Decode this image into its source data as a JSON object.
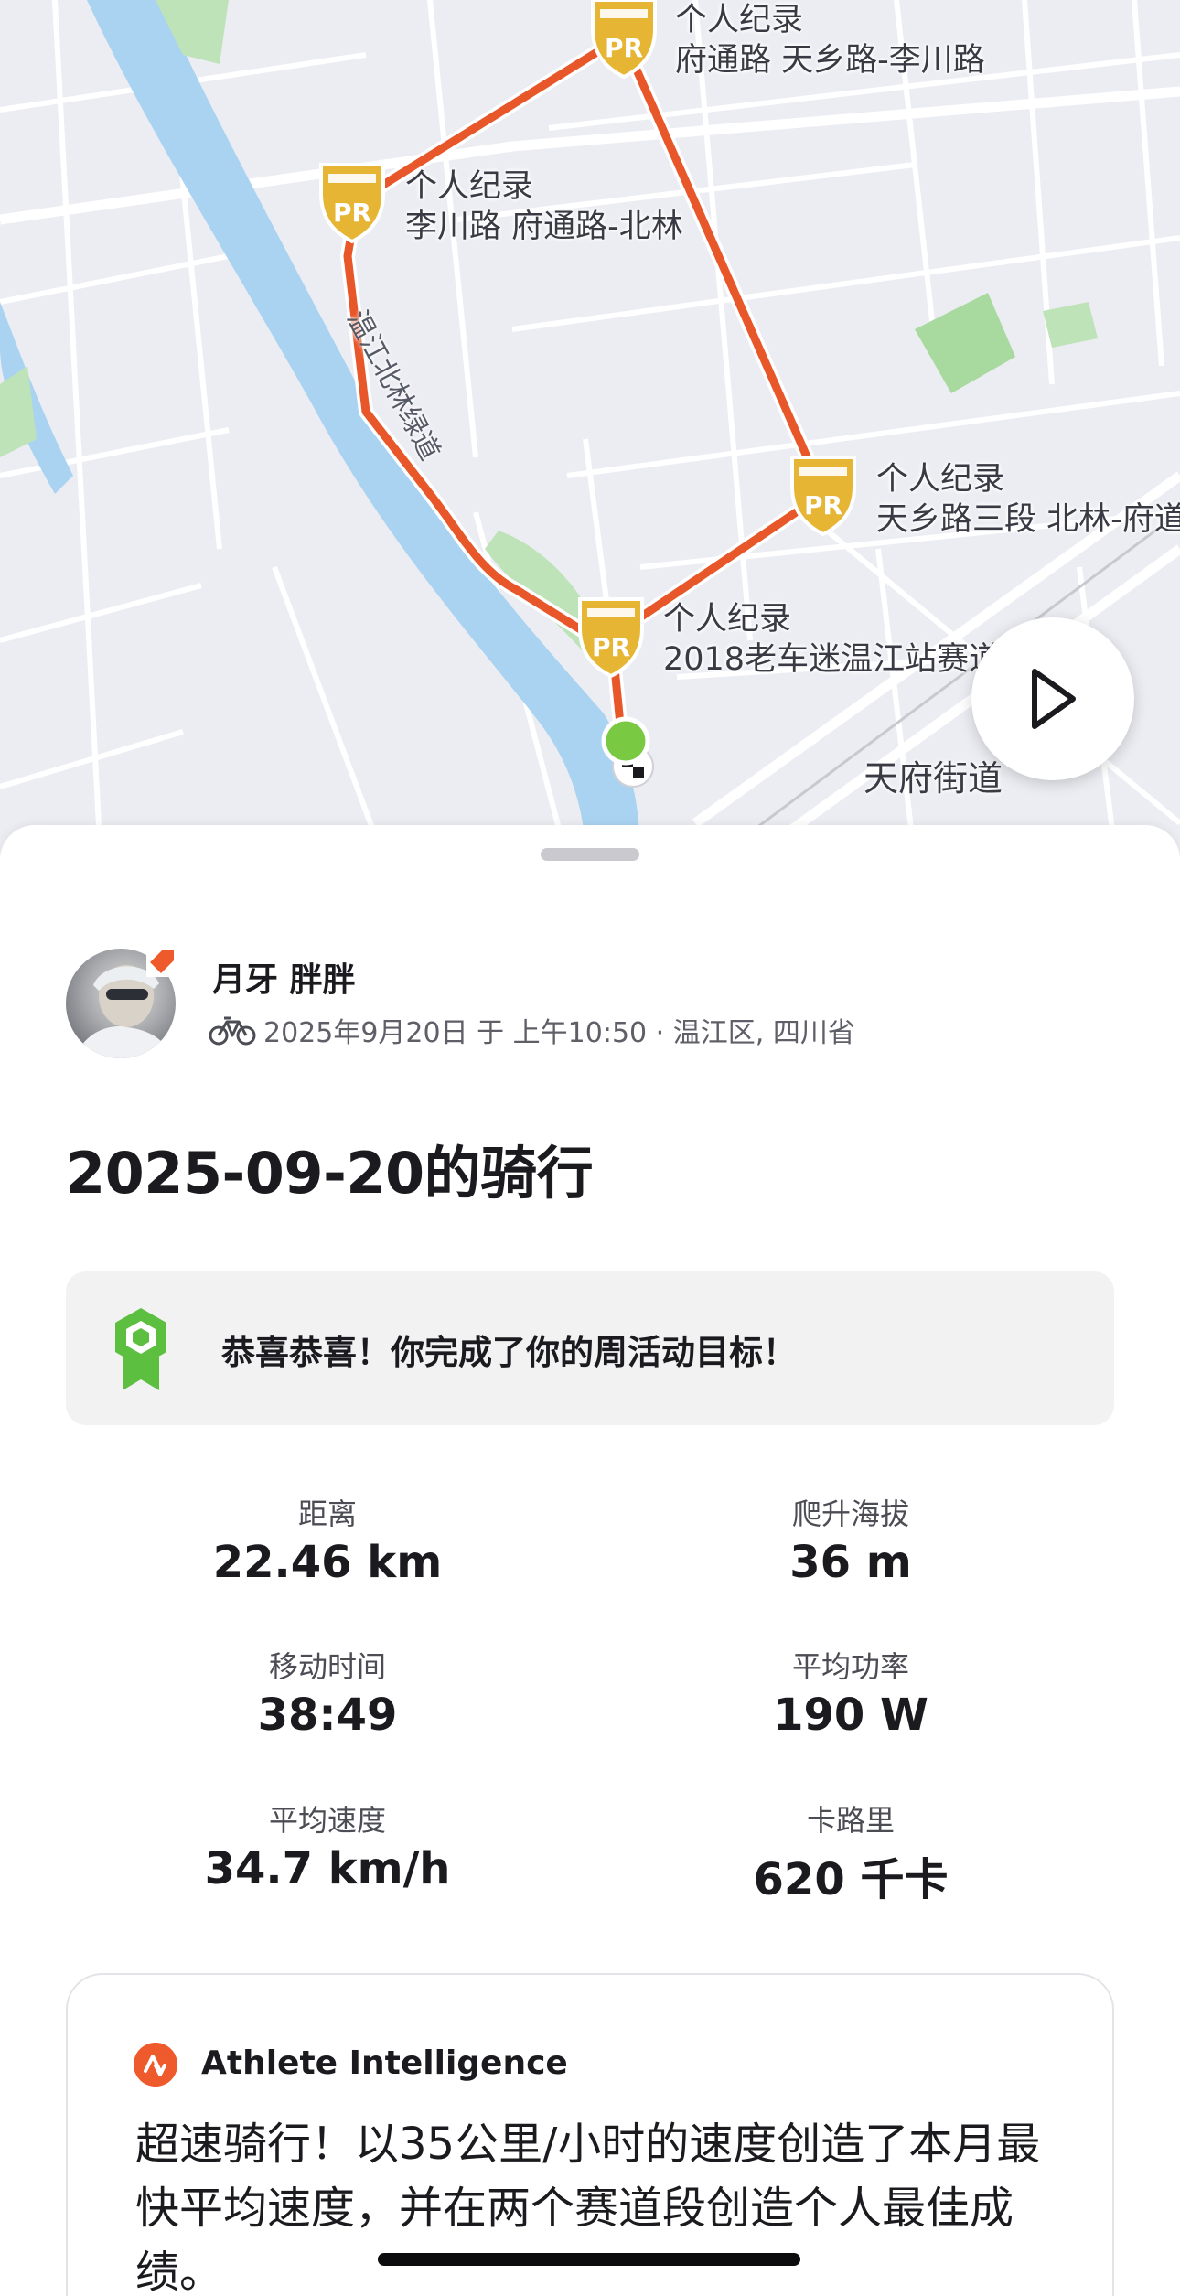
{
  "map": {
    "pr_markers": [
      {
        "title": "个人纪录",
        "segment": "府通路 天乡路-李川路"
      },
      {
        "title": "个人纪录",
        "segment": "李川路 府通路-北林"
      },
      {
        "title": "个人纪录",
        "segment": "天乡路三段 北林-府道"
      },
      {
        "title": "个人纪录",
        "segment": "2018老车迷温江站赛道"
      }
    ],
    "pr_badge_text": "PR",
    "road_label": "温江北林绿道",
    "place_label": "天府街道",
    "route_color": "#e8572a",
    "play_icon": "play-icon"
  },
  "activity": {
    "athlete_name": "月牙 胖胖",
    "meta": "2025年9月20日 于 上午10:50 · 温江区, 四川省",
    "sport_icon": "bike-icon",
    "title": "2025-09-20的骑行"
  },
  "goal": {
    "text": "恭喜恭喜！你完成了你的周活动目标！",
    "icon": "badge-icon"
  },
  "stats": [
    {
      "label": "距离",
      "value": "22.46 km"
    },
    {
      "label": "爬升海拔",
      "value": "36 m"
    },
    {
      "label": "移动时间",
      "value": "38:49"
    },
    {
      "label": "平均功率",
      "value": "190 W"
    },
    {
      "label": "平均速度",
      "value": "34.7 km/h"
    },
    {
      "label": "卡路里",
      "value": "620 千卡"
    }
  ],
  "ai": {
    "title": "Athlete Intelligence",
    "text": "超速骑行！以35公里/小时的速度创造了本月最快平均速度，并在两个赛道段创造个人最佳成绩。",
    "accent": "#ef5a2c"
  }
}
